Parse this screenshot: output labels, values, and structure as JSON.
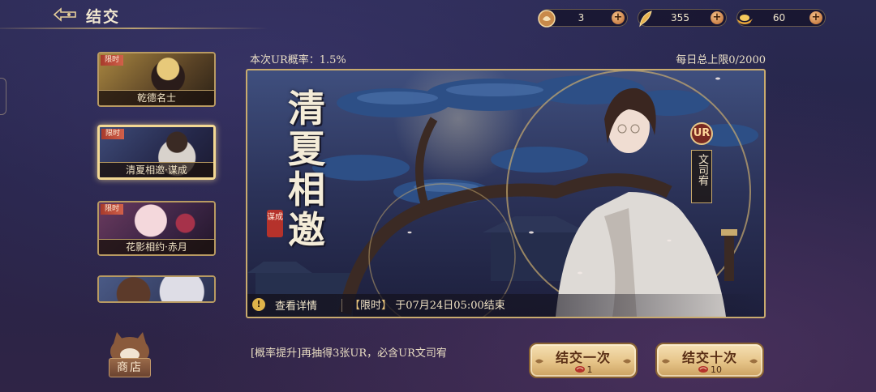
{
  "header": {
    "title": "结交",
    "currencies": [
      {
        "icon": "summon-token-icon",
        "value": "3"
      },
      {
        "icon": "feather-icon",
        "value": "355"
      },
      {
        "icon": "gold-ingot-icon",
        "value": "60"
      }
    ]
  },
  "banners": [
    {
      "tag": "限时",
      "name": "乾德名士",
      "selected": false
    },
    {
      "tag": "限时",
      "name": "清夏相邀·谋成",
      "selected": true
    },
    {
      "tag": "限时",
      "name": "花影相约·赤月",
      "selected": false
    },
    {
      "tag": "",
      "name": "",
      "selected": false
    }
  ],
  "shop": {
    "label": "商店"
  },
  "main": {
    "rate_text": "本次UR概率：1.5%",
    "daily_limit": "每日总上限0/2000",
    "banner_title_chars": [
      "清",
      "夏",
      "相",
      "邀"
    ],
    "seal_text": "谋成",
    "rarity": "UR",
    "character_name": "文司宥",
    "detail_label": "查看详情",
    "end_bracket_open": "【",
    "end_tag": "限时",
    "end_bracket_close": "】",
    "end_text": "于07月24日05:00结束",
    "hint": "[概率提升]再抽得3张UR，必含UR文司宥"
  },
  "actions": {
    "draw_once_label": "结交一次",
    "draw_once_cost": "1",
    "draw_ten_label": "结交十次",
    "draw_ten_cost": "10"
  },
  "colors": {
    "accent_gold": "#c9ab6e",
    "limited_tag": "#a83b2c",
    "button_gold": "#e6c488"
  }
}
